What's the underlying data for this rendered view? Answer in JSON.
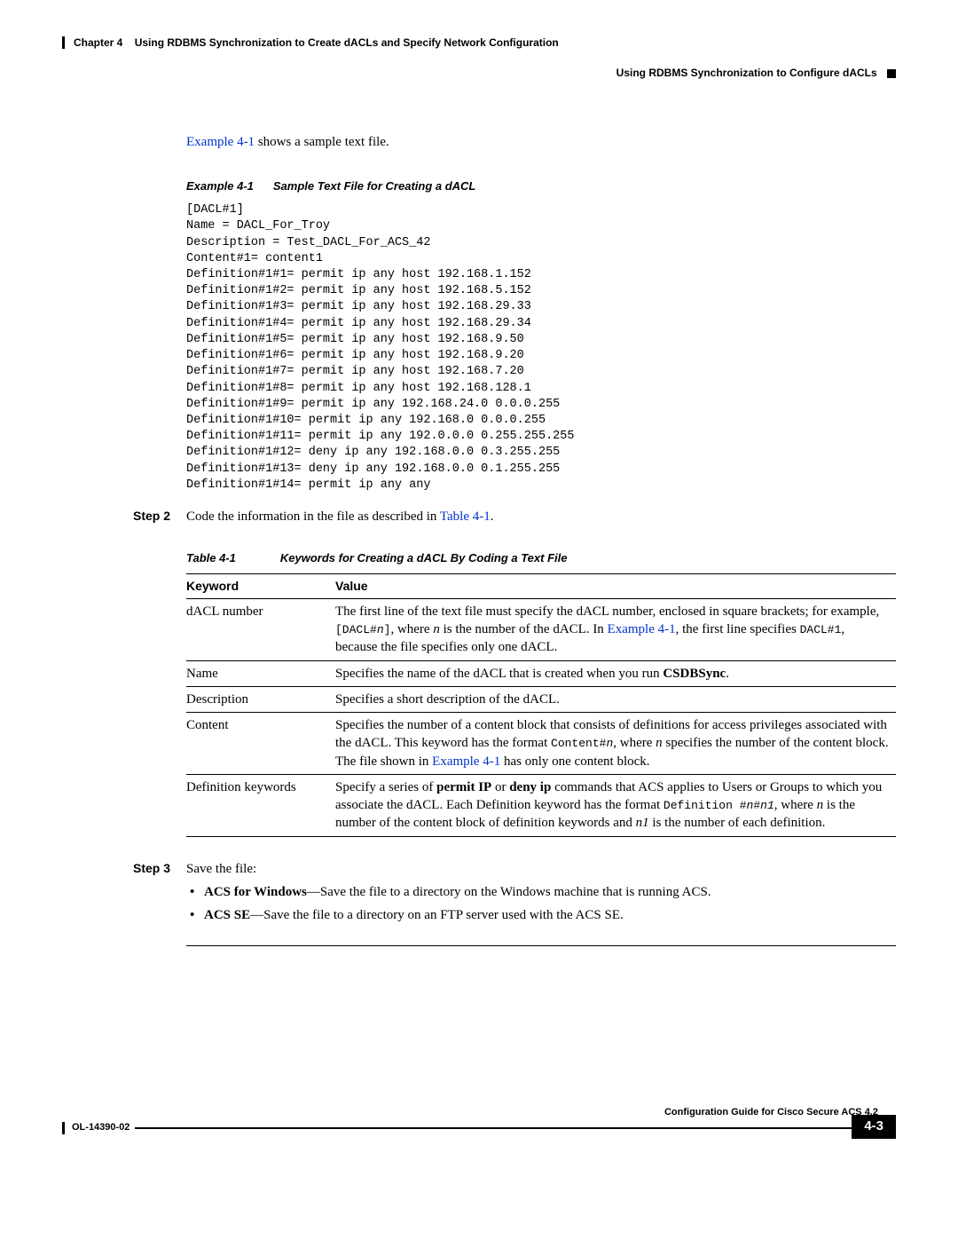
{
  "header": {
    "chapter_label": "Chapter 4",
    "chapter_title": "Using RDBMS Synchronization to Create dACLs and Specify Network Configuration",
    "section_title": "Using RDBMS Synchronization to Configure dACLs"
  },
  "intro": {
    "link_text": "Example 4-1",
    "after": " shows a sample text file."
  },
  "example": {
    "label": "Example 4-1",
    "title": "Sample Text File for Creating a dACL",
    "code": "[DACL#1]\nName = DACL_For_Troy\nDescription = Test_DACL_For_ACS_42\nContent#1= content1\nDefinition#1#1= permit ip any host 192.168.1.152\nDefinition#1#2= permit ip any host 192.168.5.152\nDefinition#1#3= permit ip any host 192.168.29.33\nDefinition#1#4= permit ip any host 192.168.29.34\nDefinition#1#5= permit ip any host 192.168.9.50\nDefinition#1#6= permit ip any host 192.168.9.20\nDefinition#1#7= permit ip any host 192.168.7.20\nDefinition#1#8= permit ip any host 192.168.128.1\nDefinition#1#9= permit ip any 192.168.24.0 0.0.0.255\nDefinition#1#10= permit ip any 192.168.0 0.0.0.255\nDefinition#1#11= permit ip any 192.0.0.0 0.255.255.255\nDefinition#1#12= deny ip any 192.168.0.0 0.3.255.255\nDefinition#1#13= deny ip any 192.168.0.0 0.1.255.255\nDefinition#1#14= permit ip any any"
  },
  "step2": {
    "label": "Step 2",
    "text_before": "Code the information in the file as described in ",
    "link": "Table 4-1",
    "after": "."
  },
  "table": {
    "label": "Table 4-1",
    "title": "Keywords for Creating a dACL By Coding a Text File",
    "headers": {
      "c1": "Keyword",
      "c2": "Value"
    },
    "rows": {
      "r1": {
        "k": "dACL number",
        "v_before": "The first line of the text file must specify the dACL number, enclosed in square brackets; for example, ",
        "v_code1": "[DACL#",
        "v_ital1": "n",
        "v_code1b": "]",
        "v_mid": ", where ",
        "v_ital2": "n",
        "v_mid2": " is the number of the dACL. In ",
        "v_link": "Example 4-1",
        "v_mid3": ", the first line specifies ",
        "v_code2": "DACL#1",
        "v_after": ", because the file specifies only one dACL."
      },
      "r2": {
        "k": "Name",
        "v_before": "Specifies the name of the dACL that is created when you run ",
        "v_bold": "CSDBSync",
        "v_after": "."
      },
      "r3": {
        "k": "Description",
        "v": "Specifies a short description of the dACL."
      },
      "r4": {
        "k": "Content",
        "v_before": "Specifies the number of a content block that consists of definitions for access privileges associated with the dACL. This keyword has the format ",
        "v_code": "Content#",
        "v_ital": "n",
        "v_mid": ", where ",
        "v_ital2": "n",
        "v_mid2": " specifies the number of the content block. The file shown in ",
        "v_link": "Example 4-1",
        "v_after": " has only one content block."
      },
      "r5": {
        "k": "Definition keywords",
        "v_before": "Specify a series of ",
        "v_bold1": "permit IP",
        "v_mid1": " or ",
        "v_bold2": "deny ip",
        "v_mid2": " commands that ACS applies to Users or Groups to which you associate the dACL. Each Definition keyword has the format ",
        "v_code": "Definition #",
        "v_ital1": "n",
        "v_code2": "#",
        "v_ital2": "n1",
        "v_mid3": ", where ",
        "v_ital3": "n",
        "v_mid4": " is the number of the content block of definition keywords and ",
        "v_ital4": "n1",
        "v_after": " is the number of each definition."
      }
    }
  },
  "step3": {
    "label": "Step 3",
    "text": "Save the file:",
    "bullets": {
      "b1": {
        "bold": "ACS for Windows",
        "rest": "—Save the file to a directory on the Windows machine that is running ACS."
      },
      "b2": {
        "bold": "ACS SE",
        "rest": "—Save the file to a directory on an FTP server used with the ACS SE."
      }
    }
  },
  "footer": {
    "guide": "Configuration Guide for Cisco Secure ACS 4.2",
    "ol": "OL-14390-02",
    "page": "4-3"
  }
}
